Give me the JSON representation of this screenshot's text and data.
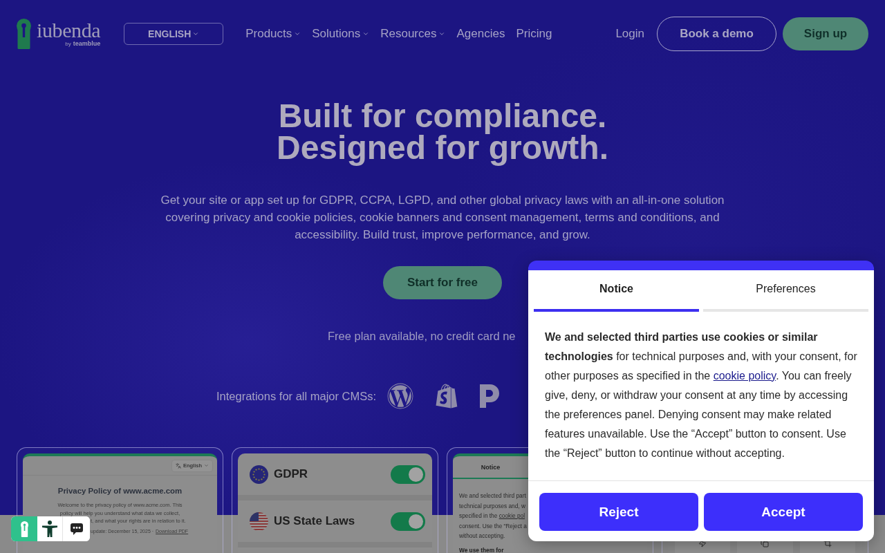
{
  "header": {
    "logo": {
      "wordmark": "iubenda",
      "by": "by",
      "brand": "teamblue"
    },
    "language": "ENGLISH",
    "nav": [
      {
        "label": "Products",
        "has_menu": true
      },
      {
        "label": "Solutions",
        "has_menu": true
      },
      {
        "label": "Resources",
        "has_menu": true
      },
      {
        "label": "Agencies",
        "has_menu": false
      },
      {
        "label": "Pricing",
        "has_menu": false
      }
    ],
    "login": "Login",
    "actions": [
      {
        "label": "Book a demo",
        "kind": "outline"
      },
      {
        "label": "Sign up",
        "kind": "solid"
      }
    ]
  },
  "hero": {
    "title_lines": [
      "Built for compliance.",
      "Designed for growth."
    ],
    "description": "Get your site or app set up for GDPR, CCPA, LGPD, and other global privacy laws with an all-in-one solution covering privacy and cookie policies, cookie banners and consent management, terms and conditions, and accessibility. Build trust, improve performance, and grow.",
    "cta": "Start for free",
    "note": "Free plan available, no credit card ne"
  },
  "integrations": {
    "label": "Integrations for all major CMSs:",
    "logos": [
      {
        "kind": "wordpress"
      },
      {
        "kind": "shopify"
      },
      {
        "kind": "p-mark"
      }
    ]
  },
  "cards": [
    {
      "kind": "policy",
      "language": "English",
      "title": "Privacy Policy of www.acme.com",
      "lines": [
        {
          "text": "Welcome to the privacy policy of www.acme.com. This",
          "covered": false
        },
        {
          "text": "policy will help you understand what data we collect,",
          "covered": false
        },
        {
          "text": "t, and what your rights are in relation to it.",
          "covered": true
        }
      ],
      "meta": {
        "text": "update: December 15, 2025 ·",
        "link": "Download PDF",
        "covered": true
      }
    },
    {
      "kind": "laws",
      "items": [
        {
          "name": "GDPR",
          "kind": "eu-flag",
          "on": true
        },
        {
          "name": "US State Laws",
          "kind": "us-flag",
          "on": true
        }
      ]
    },
    {
      "kind": "consent",
      "tabs": [
        {
          "label": "Notice",
          "selected": true
        }
      ],
      "lines": [
        {
          "text": "We and selected third part"
        },
        {
          "text": "technical purposes and, w"
        },
        {
          "text": "specified in the ",
          "link": "cookie pol"
        },
        {
          "text": "consent. Use the “Reject a"
        },
        {
          "text": "without accepting."
        }
      ],
      "subheading": "We use them for"
    },
    {
      "kind": "tools",
      "tiles": [
        {
          "kind": "zap"
        },
        {
          "kind": "copy"
        },
        {
          "kind": "crop"
        }
      ]
    }
  ],
  "cookie_banner": {
    "tabs": [
      {
        "label": "Notice",
        "selected": true
      },
      {
        "label": "Preferences",
        "selected": false
      }
    ],
    "text": "**We and selected third parties use cookies or similar technologies** for technical purposes and, with your consent, for other purposes as specified in the ",
    "link": "cookie policy",
    "text_after": ". You can freely give, deny, or withdraw your consent at any time by accessing the preferences panel. Denying consent may make related features unavailable. Use the “Accept” button to consent. Use the “Reject” button to continue without accepting.",
    "buttons": [
      "Reject",
      "Accept"
    ]
  },
  "widget": {
    "items": [
      {
        "kind": "logo"
      },
      {
        "kind": "accessibility"
      },
      {
        "kind": "chat"
      }
    ]
  }
}
